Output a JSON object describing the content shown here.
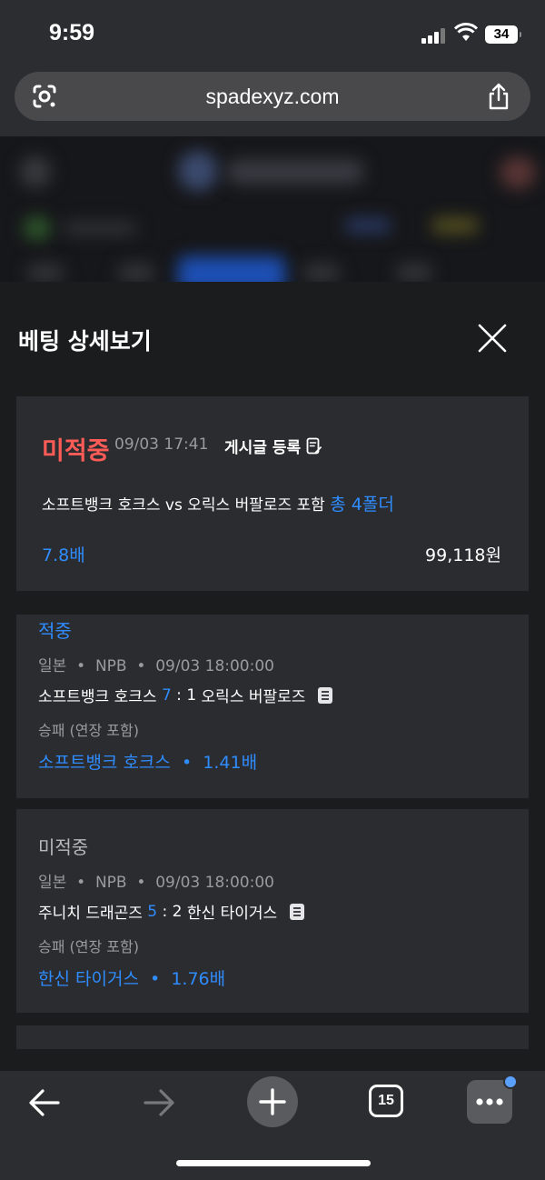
{
  "status_bar": {
    "time": "9:59",
    "battery": "34"
  },
  "browser": {
    "url": "spadexyz.com",
    "tab_count": "15"
  },
  "sheet": {
    "title": "베팅 상세보기",
    "summary": {
      "status": "미적중",
      "datetime": "09/03 17:41",
      "post_label": "게시글 등록",
      "matchup": "소프트뱅크 호크스 vs 오릭스 버팔로즈 포함",
      "folder_count": "총 4폴더",
      "odds": "7.8배",
      "amount": "99,118원"
    },
    "legs": [
      {
        "status": "적중",
        "status_color": "#2f8cff",
        "country": "일본",
        "league": "NPB",
        "datetime": "09/03 18:00:00",
        "home": "소프트뱅크 호크스",
        "home_score": "7",
        "separator": ":",
        "away_score": "1",
        "away": "오릭스 버팔로즈",
        "market": "승패 (연장 포함)",
        "pick": "소프트뱅크 호크스",
        "pick_odds": "1.41배"
      },
      {
        "status": "미적중",
        "status_color": "#b8b8bc",
        "country": "일본",
        "league": "NPB",
        "datetime": "09/03 18:00:00",
        "home": "주니치 드래곤즈",
        "home_score": "5",
        "separator": ":",
        "away_score": "2",
        "away": "한신 타이거스",
        "market": "승패 (연장 포함)",
        "pick": "한신 타이거스",
        "pick_odds": "1.76배"
      }
    ]
  },
  "meta_dot": "•",
  "colors": {
    "accent": "#2f8cff",
    "miss": "#ff5b57",
    "card": "#2b2c2f"
  }
}
